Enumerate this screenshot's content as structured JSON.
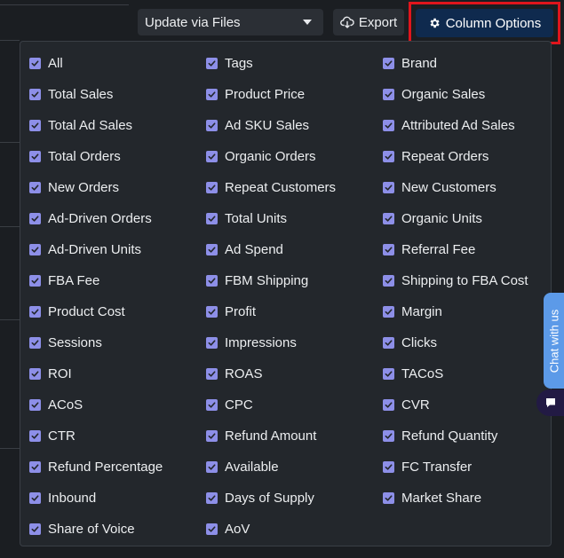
{
  "toolbar": {
    "update_select": "Update via Files",
    "export_label": "Export",
    "column_options_label": "Column Options"
  },
  "column_options": [
    {
      "label": "All",
      "checked": true
    },
    {
      "label": "Tags",
      "checked": true
    },
    {
      "label": "Brand",
      "checked": true
    },
    {
      "label": "Total Sales",
      "checked": true
    },
    {
      "label": "Product Price",
      "checked": true
    },
    {
      "label": "Organic Sales",
      "checked": true
    },
    {
      "label": "Total Ad Sales",
      "checked": true
    },
    {
      "label": "Ad SKU Sales",
      "checked": true
    },
    {
      "label": "Attributed Ad Sales",
      "checked": true
    },
    {
      "label": "Total Orders",
      "checked": true
    },
    {
      "label": "Organic Orders",
      "checked": true
    },
    {
      "label": "Repeat Orders",
      "checked": true
    },
    {
      "label": "New Orders",
      "checked": true
    },
    {
      "label": "Repeat Customers",
      "checked": true
    },
    {
      "label": "New Customers",
      "checked": true
    },
    {
      "label": "Ad-Driven Orders",
      "checked": true
    },
    {
      "label": "Total Units",
      "checked": true
    },
    {
      "label": "Organic Units",
      "checked": true
    },
    {
      "label": "Ad-Driven Units",
      "checked": true
    },
    {
      "label": "Ad Spend",
      "checked": true
    },
    {
      "label": "Referral Fee",
      "checked": true
    },
    {
      "label": "FBA Fee",
      "checked": true
    },
    {
      "label": "FBM Shipping",
      "checked": true
    },
    {
      "label": "Shipping to FBA Cost",
      "checked": true
    },
    {
      "label": "Product Cost",
      "checked": true
    },
    {
      "label": "Profit",
      "checked": true
    },
    {
      "label": "Margin",
      "checked": true
    },
    {
      "label": "Sessions",
      "checked": true
    },
    {
      "label": "Impressions",
      "checked": true
    },
    {
      "label": "Clicks",
      "checked": true
    },
    {
      "label": "ROI",
      "checked": true
    },
    {
      "label": "ROAS",
      "checked": true
    },
    {
      "label": "TACoS",
      "checked": true
    },
    {
      "label": "ACoS",
      "checked": true
    },
    {
      "label": "CPC",
      "checked": true
    },
    {
      "label": "CVR",
      "checked": true
    },
    {
      "label": "CTR",
      "checked": true
    },
    {
      "label": "Refund Amount",
      "checked": true
    },
    {
      "label": "Refund Quantity",
      "checked": true
    },
    {
      "label": "Refund Percentage",
      "checked": true
    },
    {
      "label": "Available",
      "checked": true
    },
    {
      "label": "FC Transfer",
      "checked": true
    },
    {
      "label": "Inbound",
      "checked": true
    },
    {
      "label": "Days of Supply",
      "checked": true
    },
    {
      "label": "Market Share",
      "checked": true
    },
    {
      "label": "Share of Voice",
      "checked": true
    },
    {
      "label": "AoV",
      "checked": true
    }
  ],
  "chat": {
    "label": "Chat with us",
    "icon": "chat-icon"
  },
  "colors": {
    "checkbox": "#8d8fe8",
    "primary_button": "#0f2a4e",
    "highlight_border": "#e0151c",
    "chat_tab": "#5c9ae8"
  }
}
